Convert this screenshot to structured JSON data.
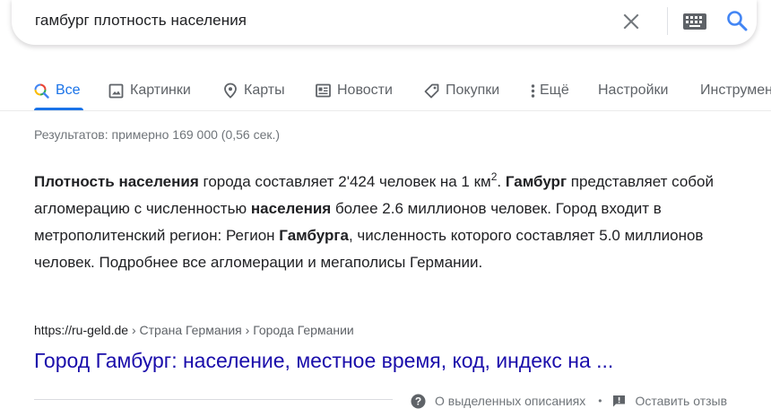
{
  "search": {
    "query": "гамбург плотность населения"
  },
  "tabs": [
    {
      "label": "Все",
      "active": true
    },
    {
      "label": "Картинки"
    },
    {
      "label": "Карты"
    },
    {
      "label": "Новости"
    },
    {
      "label": "Покупки"
    },
    {
      "label": "Ещё"
    },
    {
      "label": "Настройки"
    },
    {
      "label": "Инструменты"
    }
  ],
  "stats": "Результатов: примерно 169 000 (0,56 сек.)",
  "snippet": {
    "b1": "Плотность населения",
    "t1": " города составляет 2'424 человек на 1 км",
    "sup": "2",
    "t2": ". ",
    "b2": "Гамбург",
    "t3": " представляет собой агломерацию с численностью ",
    "b3": "населения",
    "t4": " более 2.6 миллионов человек. Город входит в метрополитенский регион: Регион ",
    "b4": "Гамбурга",
    "t5": ", численность которого составляет 5.0 миллионов человек. Подробнее все агломерации и мегаполисы Германии."
  },
  "cite": {
    "url": "https://ru-geld.de",
    "crumbs": " › Страна Германия › Города Германии"
  },
  "result_title": "Город Гамбург: население, местное время, код, индекс на ...",
  "footer": {
    "about": "О выделенных описаниях",
    "dot": "•",
    "feedback": "Оставить отзыв"
  },
  "colors": {
    "accent": "#1a73e8",
    "link": "#1a0dab",
    "text": "#202124",
    "muted": "#70757a"
  }
}
